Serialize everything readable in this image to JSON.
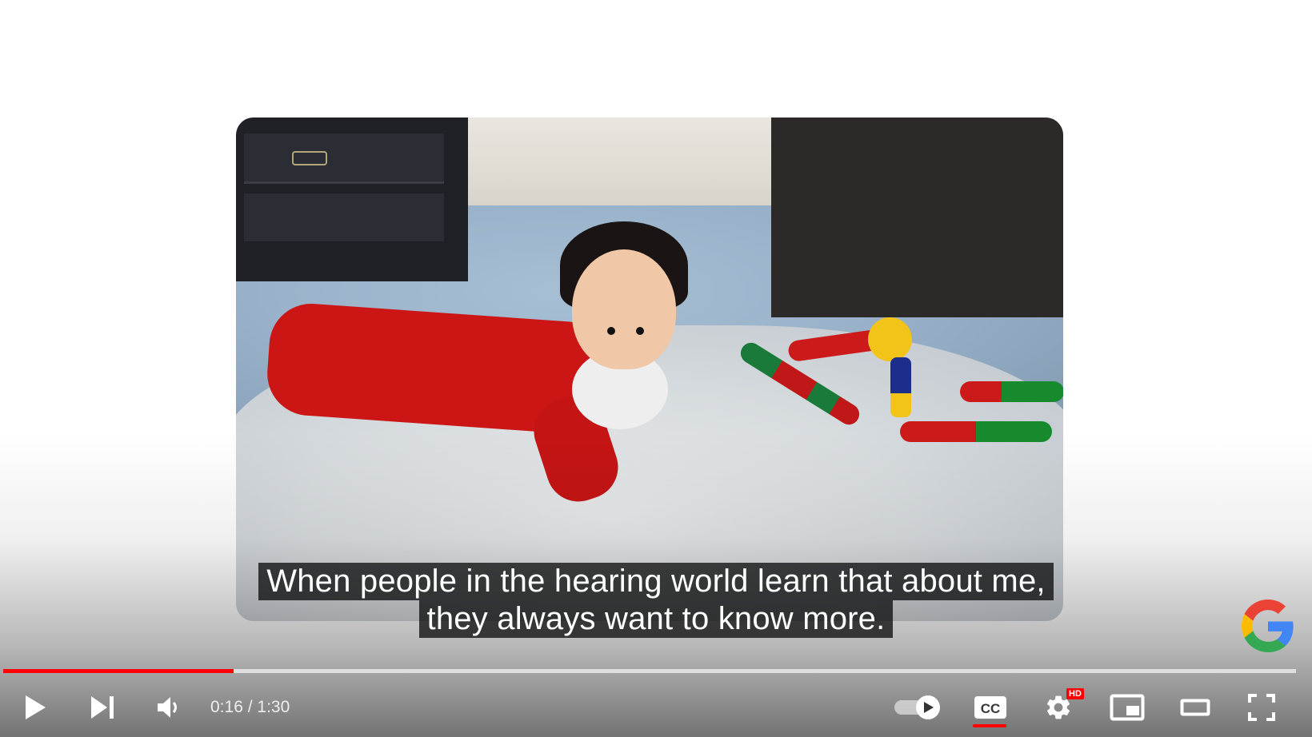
{
  "video": {
    "captions": [
      "When people in the hearing world learn that about me,",
      "they always want to know more."
    ],
    "progress_fraction": 0.178,
    "time": {
      "current": "0:16",
      "separator": " / ",
      "duration": "1:30"
    }
  },
  "controls": {
    "play_icon": "play-icon",
    "next_icon": "next-icon",
    "volume_icon": "volume-icon",
    "autoplay_icon": "autoplay-toggle-icon",
    "captions_label": "CC",
    "captions_enabled": true,
    "settings_icon": "gear-icon",
    "quality_badge": "HD",
    "miniplayer_icon": "miniplayer-icon",
    "theater_icon": "theater-mode-icon",
    "fullscreen_icon": "fullscreen-icon"
  },
  "colors": {
    "progress_played": "#ff0000",
    "hd_badge": "#ff0000",
    "cc_underline": "#ff0000"
  },
  "branding": {
    "logo": "google-g-logo"
  }
}
